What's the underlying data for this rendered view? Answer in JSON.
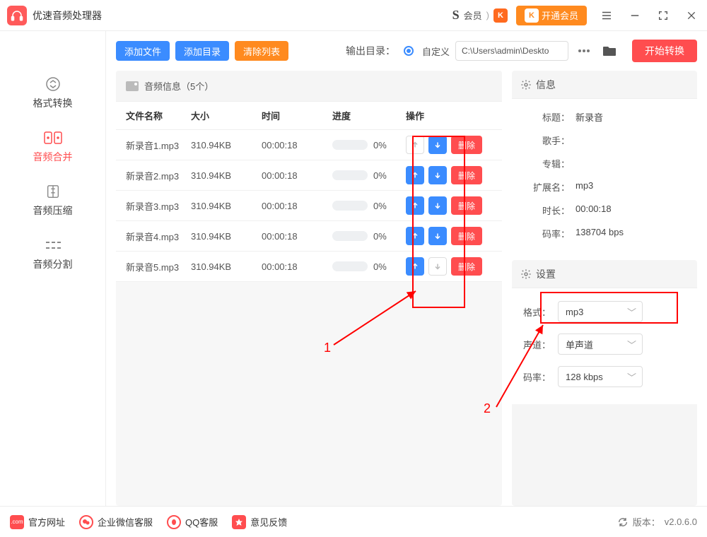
{
  "app": {
    "title": "优速音频处理器",
    "member_label": "会员"
  },
  "vip_button": "开通会员",
  "sidebar": {
    "items": [
      {
        "label": "格式转换"
      },
      {
        "label": "音频合并"
      },
      {
        "label": "音频压缩"
      },
      {
        "label": "音频分割"
      }
    ]
  },
  "toolbar": {
    "add_file": "添加文件",
    "add_dir": "添加目录",
    "clear": "清除列表",
    "output_label": "输出目录：",
    "output_mode": "自定义",
    "output_path": "C:\\Users\\admin\\Deskto",
    "start": "开始转换"
  },
  "audio_panel": {
    "title": "音频信息（5个）"
  },
  "table": {
    "headers": {
      "name": "文件名称",
      "size": "大小",
      "time": "时间",
      "progress": "进度",
      "op": "操作"
    },
    "delete_label": "删除",
    "rows": [
      {
        "name": "新录音1.mp3",
        "size": "310.94KB",
        "time": "00:00:18",
        "progress": "0%",
        "up_enabled": false,
        "down_enabled": true
      },
      {
        "name": "新录音2.mp3",
        "size": "310.94KB",
        "time": "00:00:18",
        "progress": "0%",
        "up_enabled": true,
        "down_enabled": true
      },
      {
        "name": "新录音3.mp3",
        "size": "310.94KB",
        "time": "00:00:18",
        "progress": "0%",
        "up_enabled": true,
        "down_enabled": true
      },
      {
        "name": "新录音4.mp3",
        "size": "310.94KB",
        "time": "00:00:18",
        "progress": "0%",
        "up_enabled": true,
        "down_enabled": true
      },
      {
        "name": "新录音5.mp3",
        "size": "310.94KB",
        "time": "00:00:18",
        "progress": "0%",
        "up_enabled": true,
        "down_enabled": false
      }
    ]
  },
  "info": {
    "title": "信息",
    "fields": {
      "track_title_label": "标题：",
      "track_title": "新录音",
      "artist_label": "歌手：",
      "artist": "",
      "album_label": "专辑：",
      "album": "",
      "ext_label": "扩展名：",
      "ext": "mp3",
      "duration_label": "时长：",
      "duration": "00:00:18",
      "bitrate_label": "码率：",
      "bitrate": "138704 bps"
    }
  },
  "settings": {
    "title": "设置",
    "format_label": "格式：",
    "format_value": "mp3",
    "channel_label": "声道：",
    "channel_value": "单声道",
    "bitrate_label": "码率：",
    "bitrate_value": "128 kbps"
  },
  "annotations": {
    "num1": "1",
    "num2": "2"
  },
  "footer": {
    "links": [
      {
        "label": "官方网址"
      },
      {
        "label": "企业微信客服"
      },
      {
        "label": "QQ客服"
      },
      {
        "label": "意见反馈"
      }
    ],
    "version_label": "版本：",
    "version": "v2.0.6.0"
  }
}
